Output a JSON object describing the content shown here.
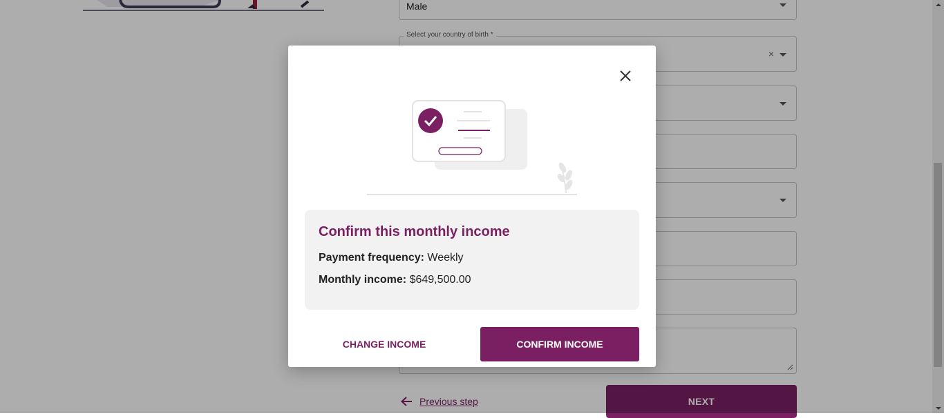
{
  "background": {
    "gender_field": {
      "value": "Male"
    },
    "country_field": {
      "label": "Select your country of birth *",
      "clear_icon": "×"
    },
    "previous_step_label": "Previous step",
    "next_label": "NEXT"
  },
  "modal": {
    "title": "Confirm this monthly income",
    "payment_frequency_label": "Payment frequency:",
    "payment_frequency_value": "Weekly",
    "monthly_income_label": "Monthly income:",
    "monthly_income_value": "$649,500.00",
    "change_button": "CHANGE INCOME",
    "confirm_button": "CONFIRM INCOME"
  },
  "colors": {
    "brand": "#7b1f63",
    "card_bg": "#f2f2f2",
    "overlay": "rgba(0,0,0,0.32)"
  },
  "icons": [
    "close-icon",
    "check-icon",
    "arrow-left-icon",
    "chevron-down-icon",
    "clear-icon"
  ]
}
